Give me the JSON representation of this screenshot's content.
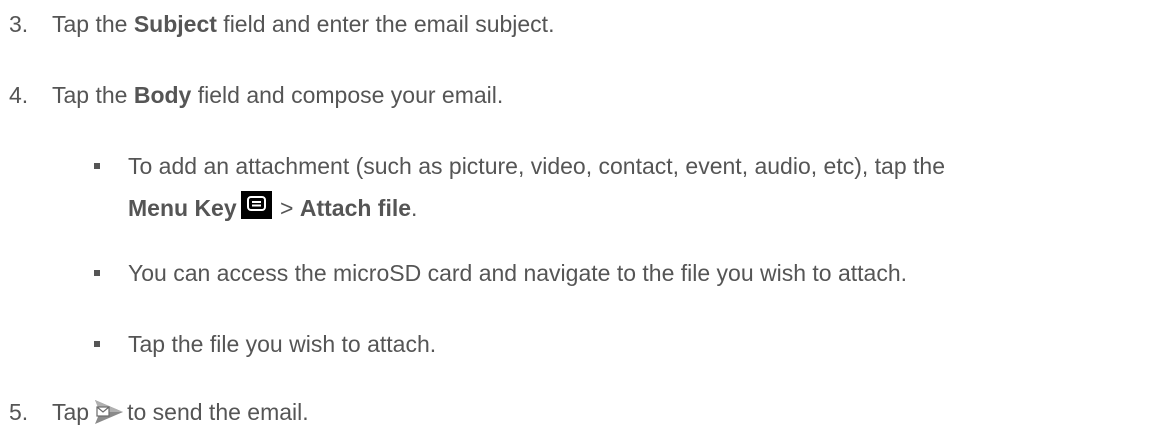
{
  "steps": [
    {
      "num": "3.",
      "pre": "Tap the ",
      "bold": "Subject",
      "post": " field and enter the email subject."
    },
    {
      "num": "4.",
      "pre": "Tap the ",
      "bold": "Body",
      "post": " field and compose your email."
    }
  ],
  "bullets": {
    "b1_line1": "To add an attachment (such as picture, video, contact, event, audio, etc), tap the",
    "b1_menu_key": "Menu Key",
    "b1_gt": ">",
    "b1_attach": "Attach file",
    "b1_period": ".",
    "b2": "You can access the microSD card and navigate to the file you wish to attach.",
    "b3": "Tap the file you wish to attach."
  },
  "step5": {
    "num": "5.",
    "pre": "Tap",
    "post": "to send the email."
  },
  "icons": {
    "menu_key": "menu-key-icon",
    "send": "send-email-icon"
  }
}
